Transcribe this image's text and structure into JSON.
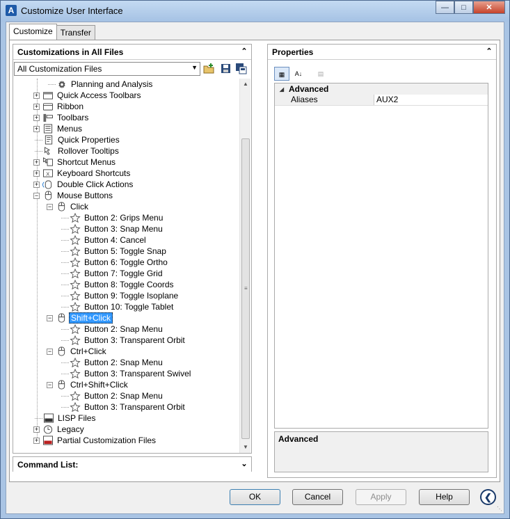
{
  "window": {
    "title": "Customize User Interface",
    "app_icon": "A",
    "controls": [
      "minimize",
      "maximize",
      "close"
    ]
  },
  "tabs": [
    {
      "label": "Customize",
      "active": true
    },
    {
      "label": "Transfer",
      "active": false
    }
  ],
  "left_panel": {
    "title": "Customizations in All Files",
    "filter": {
      "selected": "All Customization Files"
    },
    "toolbar_icons": [
      "open-file-icon",
      "save-icon",
      "save-as-icon"
    ],
    "tree": [
      {
        "label": "Planning and Analysis",
        "icon": "gear-icon",
        "level": 1,
        "expander": "none"
      },
      {
        "label": "Quick Access Toolbars",
        "icon": "toolbar-icon",
        "level": 0,
        "expander": "+"
      },
      {
        "label": "Ribbon",
        "icon": "ribbon-icon",
        "level": 0,
        "expander": "+"
      },
      {
        "label": "Toolbars",
        "icon": "toolbars-icon",
        "level": 0,
        "expander": "+"
      },
      {
        "label": "Menus",
        "icon": "menus-icon",
        "level": 0,
        "expander": "+"
      },
      {
        "label": "Quick Properties",
        "icon": "quick-properties-icon",
        "level": 0,
        "expander": "none"
      },
      {
        "label": "Rollover Tooltips",
        "icon": "rollover-icon",
        "level": 0,
        "expander": "none"
      },
      {
        "label": "Shortcut Menus",
        "icon": "shortcut-menu-icon",
        "level": 0,
        "expander": "+"
      },
      {
        "label": "Keyboard Shortcuts",
        "icon": "keyboard-icon",
        "level": 0,
        "expander": "+"
      },
      {
        "label": "Double Click Actions",
        "icon": "double-click-icon",
        "level": 0,
        "expander": "+"
      },
      {
        "label": "Mouse Buttons",
        "icon": "mouse-icon",
        "level": 0,
        "expander": "-"
      },
      {
        "label": "Click",
        "icon": "mouse-icon",
        "level": 1,
        "expander": "-"
      },
      {
        "label": "Button 2: Grips Menu",
        "icon": "star-icon",
        "level": 2,
        "expander": "none"
      },
      {
        "label": "Button 3: Snap Menu",
        "icon": "star-icon",
        "level": 2,
        "expander": "none"
      },
      {
        "label": "Button 4: Cancel",
        "icon": "star-icon",
        "level": 2,
        "expander": "none"
      },
      {
        "label": "Button 5: Toggle Snap",
        "icon": "star-icon",
        "level": 2,
        "expander": "none"
      },
      {
        "label": "Button 6: Toggle Ortho",
        "icon": "star-icon",
        "level": 2,
        "expander": "none"
      },
      {
        "label": "Button 7: Toggle Grid",
        "icon": "star-icon",
        "level": 2,
        "expander": "none"
      },
      {
        "label": "Button 8: Toggle Coords",
        "icon": "star-icon",
        "level": 2,
        "expander": "none"
      },
      {
        "label": "Button 9: Toggle Isoplane",
        "icon": "star-icon",
        "level": 2,
        "expander": "none"
      },
      {
        "label": "Button 10: Toggle Tablet",
        "icon": "star-icon",
        "level": 2,
        "expander": "none"
      },
      {
        "label": "Shift+Click",
        "icon": "mouse-icon",
        "level": 1,
        "expander": "-",
        "selected": true
      },
      {
        "label": "Button 2: Snap Menu",
        "icon": "star-icon",
        "level": 2,
        "expander": "none"
      },
      {
        "label": "Button 3: Transparent Orbit",
        "icon": "star-icon",
        "level": 2,
        "expander": "none"
      },
      {
        "label": "Ctrl+Click",
        "icon": "mouse-icon",
        "level": 1,
        "expander": "-"
      },
      {
        "label": "Button 2: Snap Menu",
        "icon": "star-icon",
        "level": 2,
        "expander": "none"
      },
      {
        "label": "Button 3: Transparent Swivel",
        "icon": "star-icon",
        "level": 2,
        "expander": "none"
      },
      {
        "label": "Ctrl+Shift+Click",
        "icon": "mouse-icon",
        "level": 1,
        "expander": "-"
      },
      {
        "label": "Button 2: Snap Menu",
        "icon": "star-icon",
        "level": 2,
        "expander": "none"
      },
      {
        "label": "Button 3: Transparent Orbit",
        "icon": "star-icon",
        "level": 2,
        "expander": "none"
      },
      {
        "label": "LISP Files",
        "icon": "lisp-icon",
        "level": 0,
        "expander": "none"
      },
      {
        "label": "Legacy",
        "icon": "legacy-icon",
        "level": 0,
        "expander": "+"
      },
      {
        "label": "Partial Customization Files",
        "icon": "cui-icon",
        "level": 0,
        "expander": "+"
      }
    ]
  },
  "command_list": {
    "title": "Command List:"
  },
  "properties": {
    "title": "Properties",
    "category": "Advanced",
    "rows": [
      {
        "name": "Aliases",
        "value": "AUX2"
      }
    ],
    "description_title": "Advanced"
  },
  "buttons": {
    "ok": "OK",
    "cancel": "Cancel",
    "apply": "Apply",
    "help": "Help"
  }
}
